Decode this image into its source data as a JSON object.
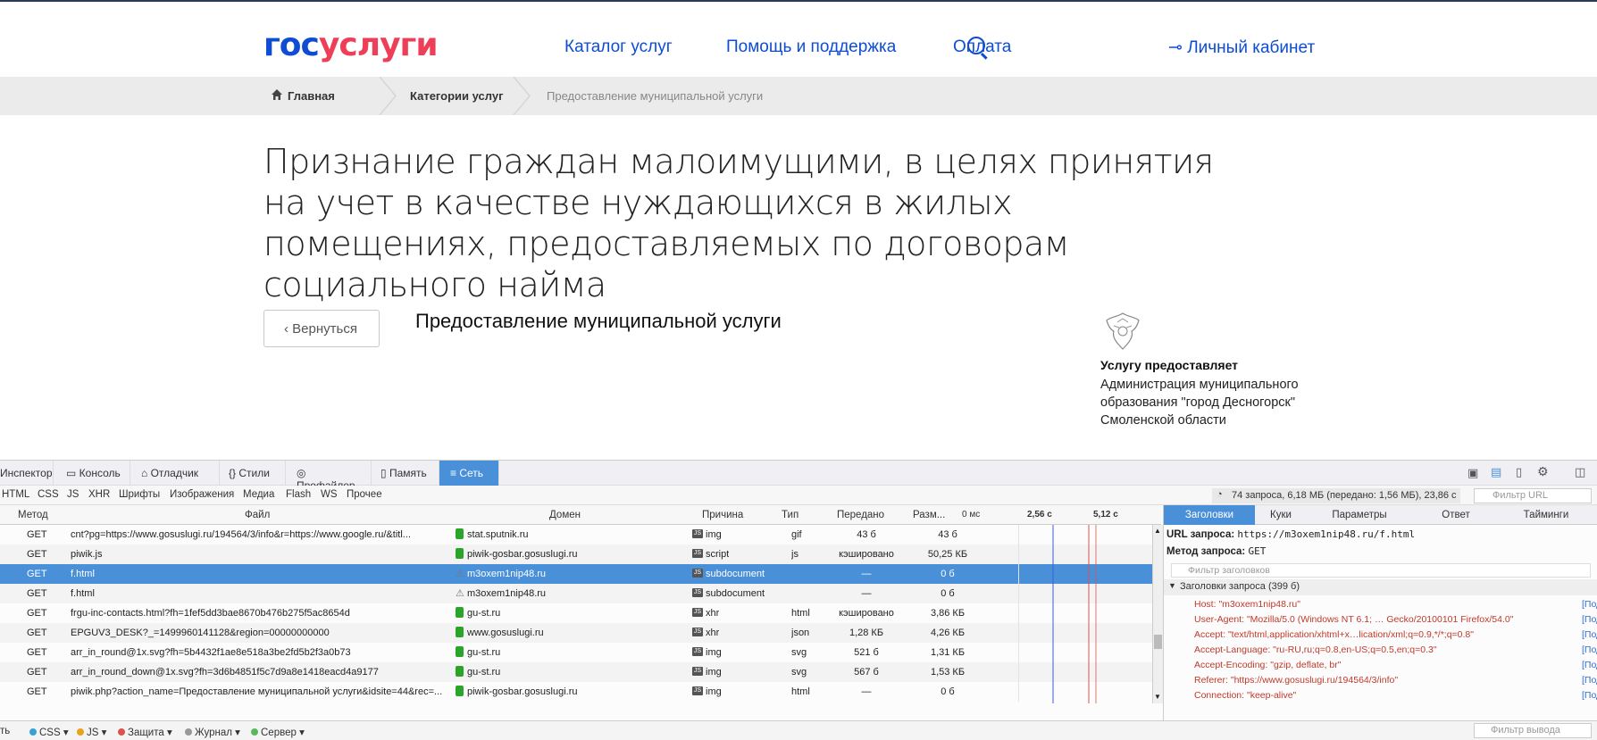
{
  "header": {
    "logo_a": "гос",
    "logo_b": "услуги",
    "nav": [
      "Каталог услуг",
      "Помощь и поддержка",
      "Оплата"
    ],
    "cabinet": "Личный кабинет"
  },
  "breadcrumbs": [
    "Главная",
    "Категории услуг",
    "Предоставление муниципальной услуги"
  ],
  "page": {
    "title": "Признание граждан малоимущими, в целях принятия на учет в качестве нуждающихся в жилых помещениях, предоставляемых по договорам социального найма",
    "back": "Вернуться",
    "subtitle": "Предоставление муниципальной услуги",
    "provider_heading": "Услугу предоставляет",
    "provider": "Администрация муниципального образования \"город Десногорск\" Смоленской области"
  },
  "devtools": {
    "tabs": [
      "Инспектор",
      "Консоль",
      "Отладчик",
      "Стили",
      "Профайлер",
      "Память",
      "Сеть"
    ],
    "filters": [
      "HTML",
      "CSS",
      "JS",
      "XHR",
      "Шрифты",
      "Изображения",
      "Медиа",
      "Flash",
      "WS",
      "Прочее"
    ],
    "summary": "74 запроса, 6,18 МБ (передано: 1,56 МБ), 23,86 с",
    "url_filter_placeholder": "Фильтр URL",
    "columns": [
      "Метод",
      "Файл",
      "Домен",
      "Причина",
      "Тип",
      "Передано",
      "Разм...",
      "0 мс",
      "2,56 с",
      "5,12 с"
    ],
    "rows": [
      {
        "method": "GET",
        "file": "cnt?pg=https://www.gosuslugi.ru/194564/3/info&r=https://www.google.ru/&titl...",
        "domain": "stat.sputnik.ru",
        "cause": "img",
        "type": "gif",
        "transferred": "43 б",
        "size": "43 б",
        "lock": "ok"
      },
      {
        "method": "GET",
        "file": "piwik.js",
        "domain": "piwik-gosbar.gosuslugi.ru",
        "cause": "script",
        "type": "js",
        "transferred": "кэшировано",
        "size": "50,25 КБ",
        "lock": "ok"
      },
      {
        "method": "GET",
        "file": "f.html",
        "domain": "m3oxem1nip48.ru",
        "cause": "subdocument",
        "type": "",
        "transferred": "—",
        "size": "0 б",
        "lock": "warn"
      },
      {
        "method": "GET",
        "file": "f.html",
        "domain": "m3oxem1nip48.ru",
        "cause": "subdocument",
        "type": "",
        "transferred": "—",
        "size": "0 б",
        "lock": "warn"
      },
      {
        "method": "GET",
        "file": "frgu-inc-contacts.html?fh=1fef5dd3bae8670b476b275f5ac8654d",
        "domain": "gu-st.ru",
        "cause": "xhr",
        "type": "html",
        "transferred": "кэшировано",
        "size": "3,86 КБ",
        "lock": "ok"
      },
      {
        "method": "GET",
        "file": "EPGUV3_DESK?_=1499960141128&region=00000000000",
        "domain": "www.gosuslugi.ru",
        "cause": "xhr",
        "type": "json",
        "transferred": "1,28 КБ",
        "size": "4,26 КБ",
        "lock": "ok"
      },
      {
        "method": "GET",
        "file": "arr_in_round@1x.svg?fh=5b4432f1ae8e518a3be2fd5b2f3a0b73",
        "domain": "gu-st.ru",
        "cause": "img",
        "type": "svg",
        "transferred": "521 б",
        "size": "1,31 КБ",
        "lock": "ok"
      },
      {
        "method": "GET",
        "file": "arr_in_round_down@1x.svg?fh=3d6b4851f5c7d9a8e1418eacd4a9177",
        "domain": "gu-st.ru",
        "cause": "img",
        "type": "svg",
        "transferred": "567 б",
        "size": "1,53 КБ",
        "lock": "ok"
      },
      {
        "method": "GET",
        "file": "piwik.php?action_name=Предоставление муниципальной услуги&idsite=44&rec=...",
        "domain": "piwik-gosbar.gosuslugi.ru",
        "cause": "img",
        "type": "html",
        "transferred": "—",
        "size": "0 б",
        "lock": "ok"
      }
    ],
    "right_tabs": [
      "Заголовки",
      "Куки",
      "Параметры",
      "Ответ",
      "Тайминги"
    ],
    "url_label": "URL запроса:",
    "url_value": "https://m3oxem1nip48.ru/f.html",
    "method_label": "Метод запроса:",
    "method_value": "GET",
    "headers_filter": "Фильтр заголовков",
    "request_headers": "Заголовки запроса (399 б)",
    "headers": [
      {
        "k": "Host:",
        "v": "\"m3oxem1nip48.ru\""
      },
      {
        "k": "User-Agent:",
        "v": "\"Mozilla/5.0 (Windows NT 6.1; … Gecko/20100101 Firefox/54.0\""
      },
      {
        "k": "Accept:",
        "v": "\"text/html,application/xhtml+x…lication/xml;q=0.9,*/*;q=0.8\""
      },
      {
        "k": "Accept-Language:",
        "v": "\"ru-RU,ru;q=0.8,en-US;q=0.5,en;q=0.3\""
      },
      {
        "k": "Accept-Encoding:",
        "v": "\"gzip, deflate, br\""
      },
      {
        "k": "Referer:",
        "v": "\"https://www.gosuslugi.ru/194564/3/info\""
      },
      {
        "k": "Connection:",
        "v": "\"keep-alive\""
      }
    ],
    "header_more": "[Под",
    "bottom": [
      "ть",
      "CSS",
      "JS",
      "Защита",
      "Журнал",
      "Сервер"
    ],
    "output_filter": "Фильтр вывода"
  }
}
